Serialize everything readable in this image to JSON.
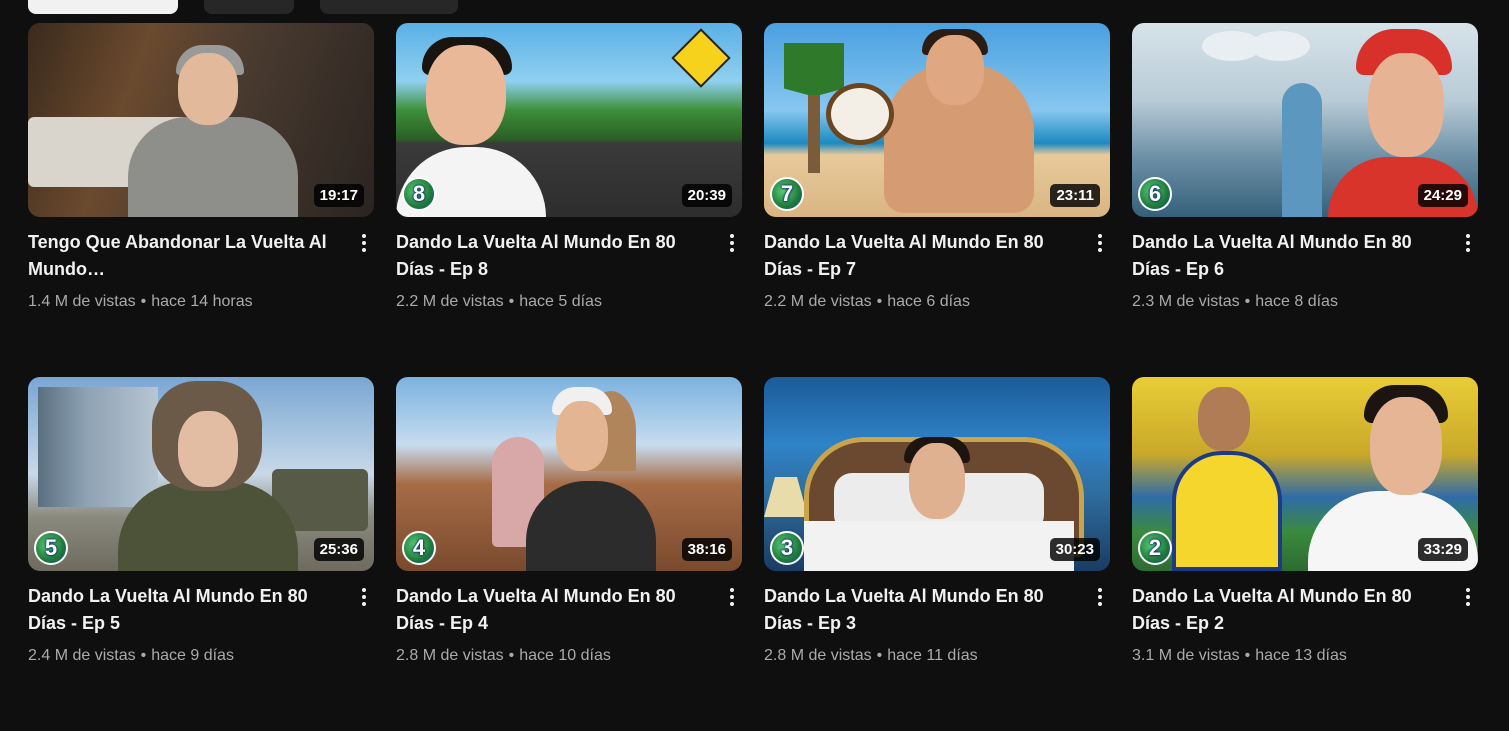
{
  "videos": [
    {
      "title": "Tengo Que Abandonar La Vuelta Al Mundo…",
      "views": "1.4 M de vistas",
      "age": "hace 14 horas",
      "duration": "19:17",
      "episode": "",
      "thumb": "art-hotel"
    },
    {
      "title": "Dando La Vuelta Al Mundo En 80 Días - Ep 8",
      "views": "2.2 M de vistas",
      "age": "hace 5 días",
      "duration": "20:39",
      "episode": "8",
      "thumb": "art-road"
    },
    {
      "title": "Dando La Vuelta Al Mundo En 80 Días - Ep 7",
      "views": "2.2 M de vistas",
      "age": "hace 6 días",
      "duration": "23:11",
      "episode": "7",
      "thumb": "art-beach"
    },
    {
      "title": "Dando La Vuelta Al Mundo En 80 Días - Ep 6",
      "views": "2.3 M de vistas",
      "age": "hace 8 días",
      "duration": "24:29",
      "episode": "6",
      "thumb": "art-surgery"
    },
    {
      "title": "Dando La Vuelta Al Mundo En 80 Días - Ep 5",
      "views": "2.4 M de vistas",
      "age": "hace 9 días",
      "duration": "25:36",
      "episode": "5",
      "thumb": "art-military"
    },
    {
      "title": "Dando La Vuelta Al Mundo En 80 Días - Ep 4",
      "views": "2.8 M de vistas",
      "age": "hace 10 días",
      "duration": "38:16",
      "episode": "4",
      "thumb": "art-market"
    },
    {
      "title": "Dando La Vuelta Al Mundo En 80 Días - Ep 3",
      "views": "2.8 M de vistas",
      "age": "hace 11 días",
      "duration": "30:23",
      "episode": "3",
      "thumb": "art-bed"
    },
    {
      "title": "Dando La Vuelta Al Mundo En 80 Días - Ep 2",
      "views": "3.1 M de vistas",
      "age": "hace 13 días",
      "duration": "33:29",
      "episode": "2",
      "thumb": "art-stadium"
    }
  ],
  "separator": "•",
  "icons": {
    "more": "more-vert-icon",
    "episode_badge": "episode-globe-badge-icon"
  },
  "colors": {
    "background": "#0f0f0f",
    "title": "#f1f1f1",
    "meta": "#aaaaaa",
    "chip_active": "#f1f1f1",
    "chip": "#272727"
  }
}
